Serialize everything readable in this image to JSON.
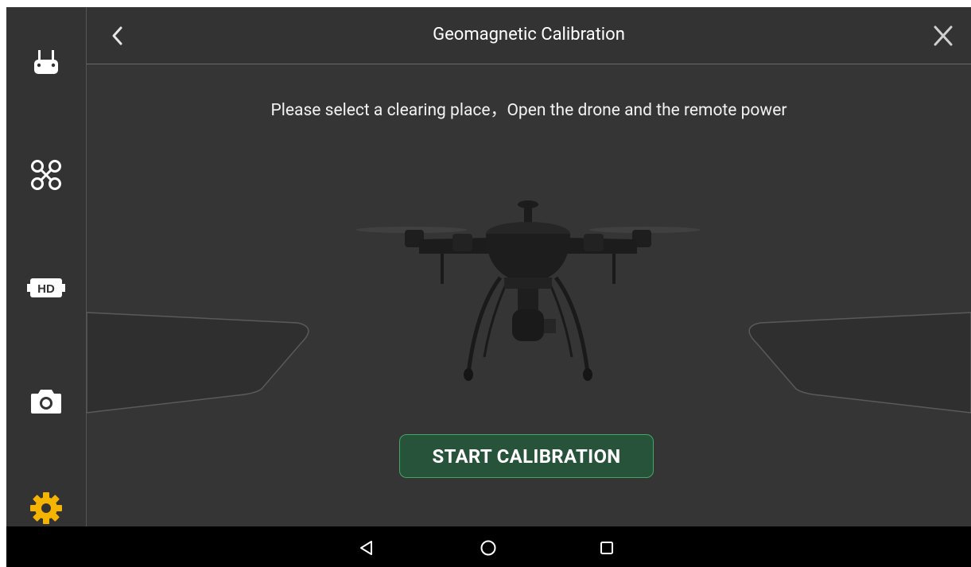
{
  "header": {
    "title": "Geomagnetic Calibration",
    "back_icon": "chevron-left-icon",
    "close_icon": "close-icon"
  },
  "sidebar": {
    "items": [
      {
        "name": "remote-controller",
        "icon": "remote-controller-icon",
        "active": false
      },
      {
        "name": "aircraft",
        "icon": "drone-icon",
        "active": false
      },
      {
        "name": "hd-transmission",
        "icon": "hd-icon",
        "active": false
      },
      {
        "name": "camera",
        "icon": "camera-icon",
        "active": false
      },
      {
        "name": "settings",
        "icon": "gear-icon",
        "active": true
      }
    ]
  },
  "main": {
    "instruction": "Please select a clearing place，Open the drone and the remote power",
    "start_button": "START CALIBRATION"
  },
  "system_nav": {
    "back_icon": "nav-back-icon",
    "home_icon": "nav-home-icon",
    "recents_icon": "nav-recents-icon"
  },
  "colors": {
    "background": "#353535",
    "accent": "#f5b400",
    "button_fill": "#28533b",
    "button_border": "#3fa865"
  }
}
